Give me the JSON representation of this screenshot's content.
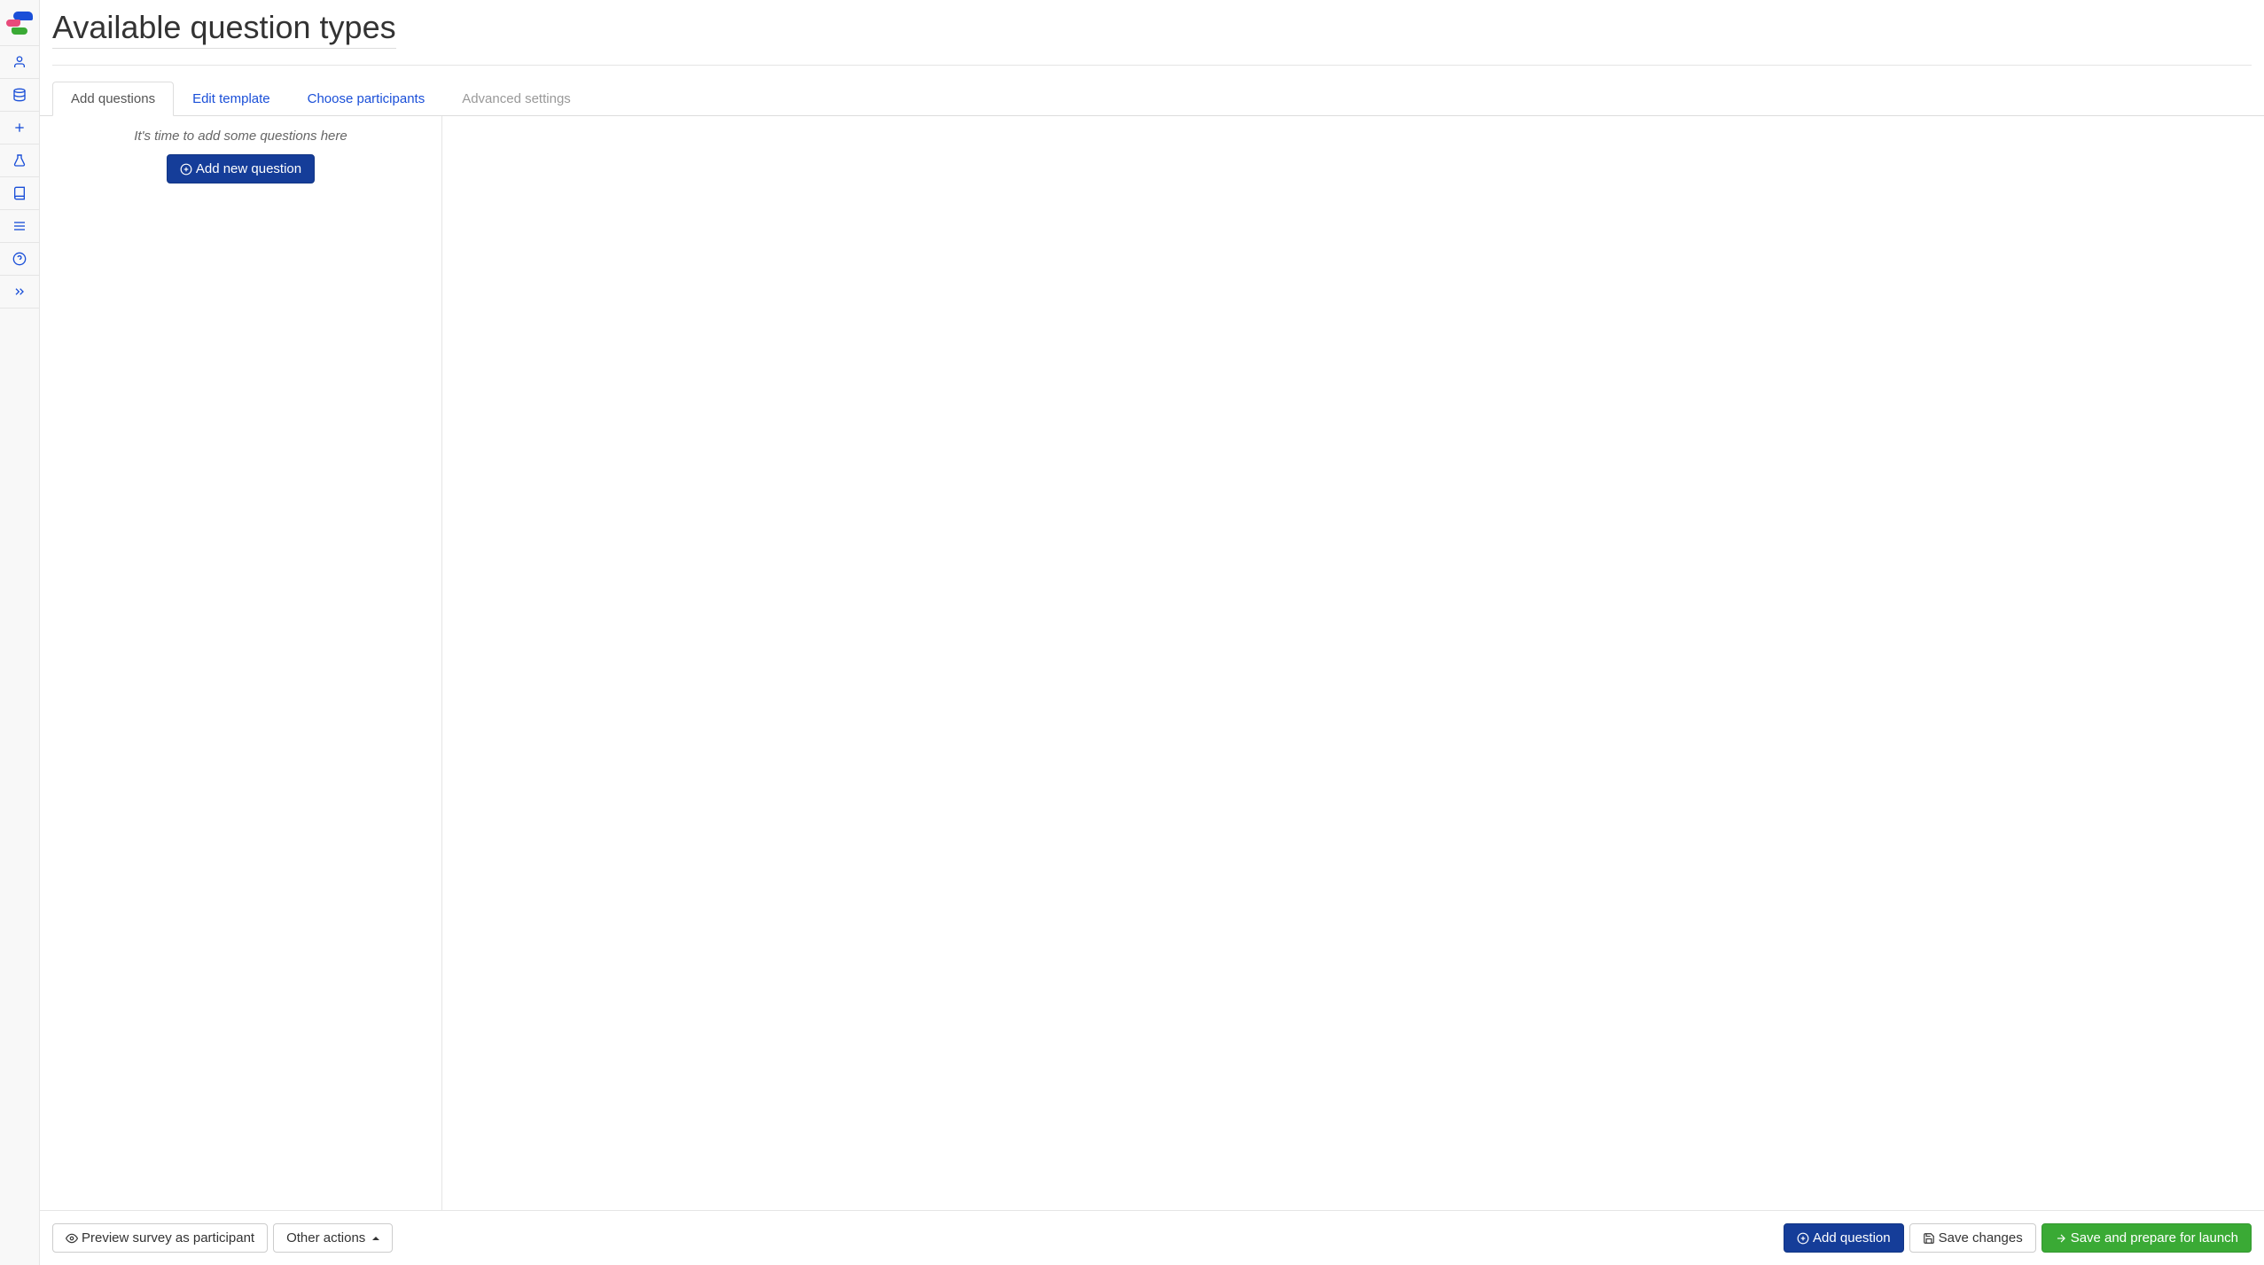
{
  "header": {
    "title": "Available question types"
  },
  "tabs": [
    {
      "label": "Add questions",
      "state": "active"
    },
    {
      "label": "Edit template",
      "state": "normal"
    },
    {
      "label": "Choose participants",
      "state": "normal"
    },
    {
      "label": "Advanced settings",
      "state": "disabled"
    }
  ],
  "leftPanel": {
    "emptyMessage": "It's time to add some questions here",
    "addButtonLabel": "Add new question"
  },
  "footer": {
    "previewLabel": "Preview survey as participant",
    "otherActionsLabel": "Other actions",
    "addQuestionLabel": "Add question",
    "saveChangesLabel": "Save changes",
    "saveLaunchLabel": "Save and prepare for launch"
  },
  "sidebar": {
    "items": [
      "user-icon",
      "database-icon",
      "plus-icon",
      "flask-icon",
      "book-icon",
      "menu-icon",
      "help-icon",
      "expand-icon"
    ]
  }
}
